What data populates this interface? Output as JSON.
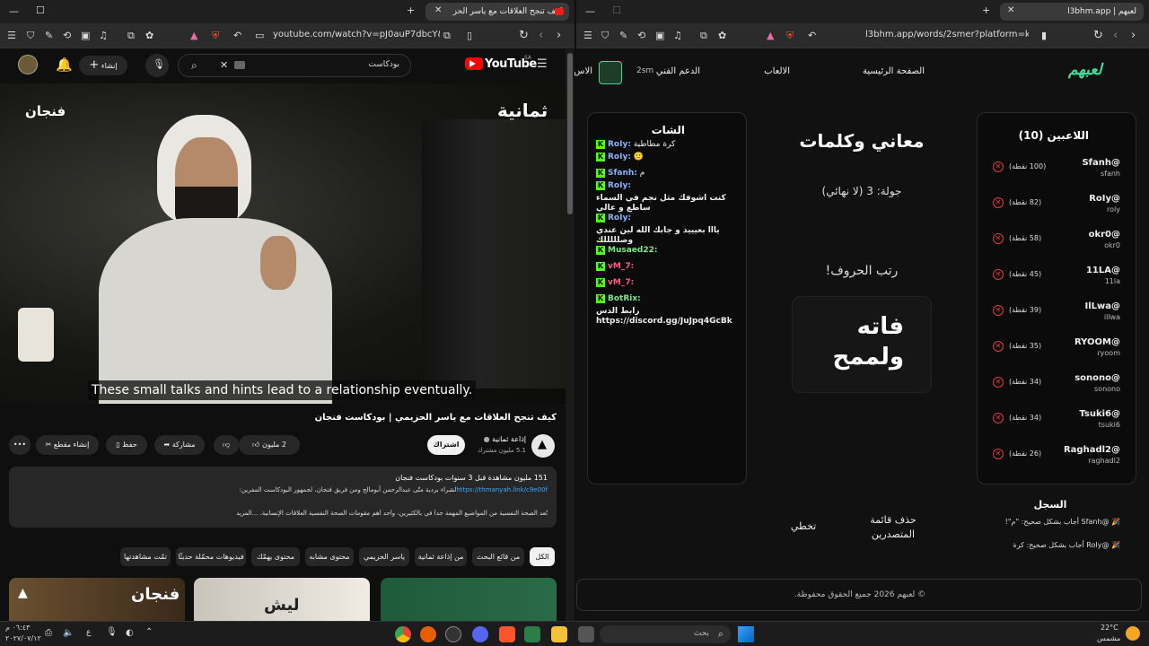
{
  "browser_left": {
    "tabs": [
      {
        "label": "كيف تنجح العلاقات مع ياسر الحز",
        "active": true
      }
    ],
    "url": "youtube.com/watch?v=pJ0auP7dbcY&t=6..."
  },
  "youtube": {
    "logo": "YouTube",
    "region": "SA",
    "search_value": "بودكاست",
    "create_label": "إنشاء",
    "video": {
      "left_logo": "فنجان",
      "right_logo": "ثمانية",
      "caption": "These small talks and hints lead to a relationship eventually.",
      "title": "كيف تنجح العلاقات مع ياسر الحزيمي | بودكاست فنجان"
    },
    "channel": {
      "name": "إذاعة ثمانية",
      "subs": "5.1 مليون مشترك",
      "subscribe": "اشتراك"
    },
    "actions": {
      "likes": "2 مليون",
      "share": "مشاركة",
      "save": "حفظ",
      "clip": "إنشاء مقطع"
    },
    "description": {
      "stats": "151 مليون مشاهدة  قبل 3 سنوات  بودكاست فنجان",
      "line2_link": "https://thmanyah.link/c9e00f",
      "line2_text": "لشراء بردية متّى عبدالرحمن أبومالح ومن فريق فنجان، لجمهور البودكاست المفرين:",
      "line3": "تُعد الصحة النفسية من المواضيع المهمة جداً في بالكثيرين، وأحد أهم مقومات الصحة النفسية العلاقات الإنسانية. ...المزيد"
    },
    "chips": [
      "الكل",
      "من قائع البحث",
      "من إذاعة ثمانية",
      "ياسر الحزيمي",
      "محتوى مشابه",
      "محتوى يهمّك",
      "فيديوهات محمّلة حديثًا",
      "تمّت مشاهدتها"
    ],
    "thumb_text": [
      "فنجان",
      "ليش"
    ]
  },
  "browser_right": {
    "tabs": [
      {
        "label": "لعبهم | l3bhm.app",
        "active": true
      }
    ],
    "url": "l3bhm.app/words/2smer?platform=kick"
  },
  "game": {
    "logo": "لعبهم",
    "nav": [
      "الصفحة الرئيسية",
      "الالعاب",
      "الدعم الفني",
      "الاس"
    ],
    "user_label": "2sm",
    "players_title": "اللاعبين (10)",
    "players": [
      {
        "name": "@Sfanh",
        "user": "sfanh",
        "points": "(100 نقطة)"
      },
      {
        "name": "@RoIy",
        "user": "roly",
        "points": "(82 نقطة)"
      },
      {
        "name": "@okr0",
        "user": "okr0",
        "points": "(58 نقطة)"
      },
      {
        "name": "@11LA",
        "user": "11la",
        "points": "(45 نقطة)"
      },
      {
        "name": "@IlLwa",
        "user": "illwa",
        "points": "(39 نقطة)"
      },
      {
        "name": "@RYOOM",
        "user": "ryoom",
        "points": "(35 نقطة)"
      },
      {
        "name": "@sonono",
        "user": "sonono",
        "points": "(34 نقطة)"
      },
      {
        "name": "@Tsuki6",
        "user": "tsuki6",
        "points": "(34 نقطة)"
      },
      {
        "name": "@Raghadl2",
        "user": "raghadl2",
        "points": "(26 نقطة)"
      }
    ],
    "game_title": "معاني وكلمات",
    "round": "جولة: 3 (لا نهائي)",
    "prompt": "رتب الحروف!",
    "scrambled": "فاته ولممح",
    "clear_label": "حذف قائمة المتصدرين",
    "skip_label": "تخطي",
    "chat_title": "الشات",
    "chat": [
      {
        "user": "RoIy:",
        "text": "كرة مطاطية",
        "color": "#8ab4f8"
      },
      {
        "user": "RoIy:",
        "text": "🙂",
        "color": "#8ab4f8"
      },
      {
        "user": "Sfanh:",
        "text": "م",
        "color": "#8ab4f8"
      },
      {
        "user": "RoIy:",
        "text": "",
        "color": "#8ab4f8"
      },
      {
        "user": "",
        "text": "كنت اشوفك مثل نجم في السماء",
        "color": "#8ab4f8"
      },
      {
        "user": "",
        "text": "ساطع و عالي",
        "color": "#8ab4f8"
      },
      {
        "user": "RoIy:",
        "text": "",
        "color": "#8ab4f8"
      },
      {
        "user": "",
        "text": "يااا بعيييد و جابك الله لين عندي",
        "color": "#8ab4f8"
      },
      {
        "user": "",
        "text": "وصلللللك",
        "color": "#8ab4f8"
      },
      {
        "user": "Musaed22:",
        "text": "",
        "color": "#7ee787"
      },
      {
        "user": "vM_7:",
        "text": "",
        "color": "#ff5c8a"
      },
      {
        "user": "vM_7:",
        "text": "",
        "color": "#ff5c8a"
      },
      {
        "user": "BotRix:",
        "text": "",
        "color": "#7ee787"
      },
      {
        "user": "",
        "text": "رابط الدس",
        "color": "#7ee787"
      },
      {
        "user": "",
        "text": "https://discord.gg/JuJpq4GcBk",
        "color": "#7ee787"
      }
    ],
    "log_title": "السجل",
    "log": [
      "@Sfanh أجاب بشكل صحيح: \"م\"!",
      "@RoIy أجاب بشكل صحيح: كرة"
    ],
    "footer": "© لعبهم 2026 جميع الحقوق محفوظة."
  },
  "taskbar": {
    "search": "بحث",
    "temp": "22°C",
    "weather": "مشمس",
    "time": "٠٦:٤٣ م",
    "date": "٢٠٢٧/٠٧/١٢",
    "lang": "ع"
  }
}
